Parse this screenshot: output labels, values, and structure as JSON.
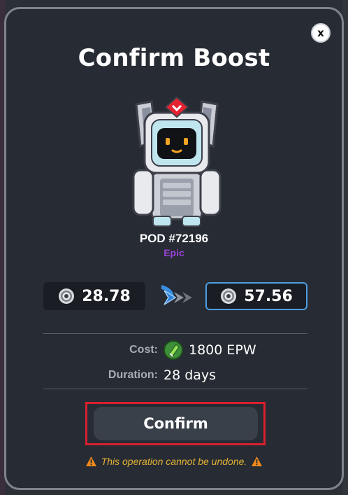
{
  "modal": {
    "title": "Confirm Boost",
    "close_label": "x"
  },
  "pod": {
    "id": "POD #72196",
    "rarity": "Epic",
    "rarity_color": "#9b42d9",
    "image": "robot-pod-icon"
  },
  "boost": {
    "current_value": "28.78",
    "boosted_value": "57.56",
    "stat_icon": "gear-icon",
    "arrow_icon": "double-chevron-right-icon"
  },
  "details": {
    "cost_label": "Cost:",
    "cost_value": "1800 EPW",
    "cost_icon": "epw-token-icon",
    "duration_label": "Duration:",
    "duration_value": "28 days"
  },
  "actions": {
    "confirm_label": "Confirm"
  },
  "warning": {
    "text": "This operation cannot be undone.",
    "color": "#e3b335"
  },
  "colors": {
    "accent_blue": "#4c9fe6",
    "highlight_red": "#d8202f",
    "modal_bg": "#272b33"
  }
}
